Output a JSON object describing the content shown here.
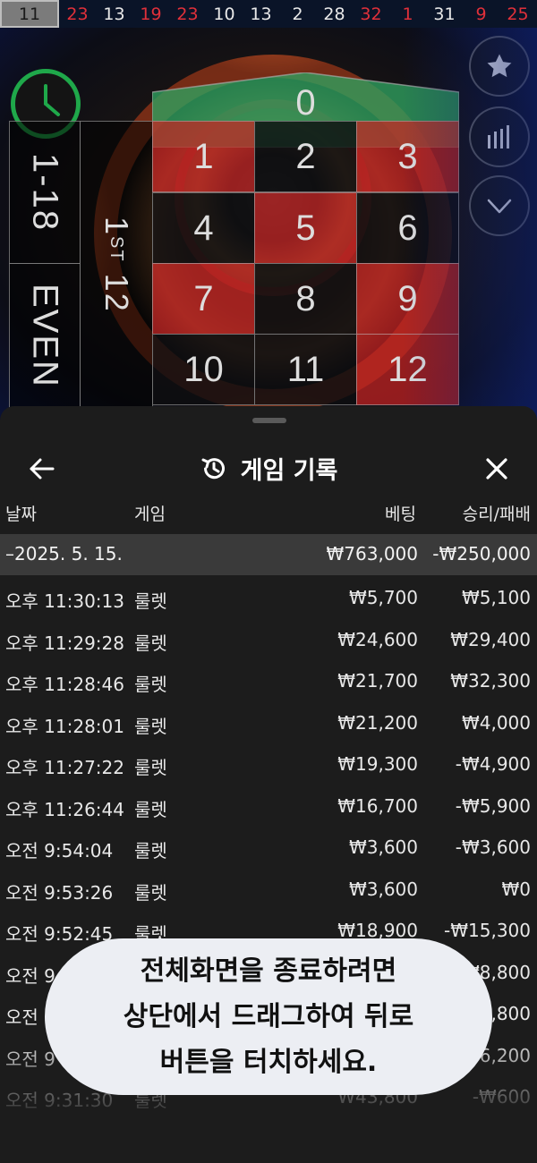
{
  "history": [
    {
      "n": "11",
      "color": "grey"
    },
    {
      "n": "23",
      "color": "red"
    },
    {
      "n": "13",
      "color": "black"
    },
    {
      "n": "19",
      "color": "red"
    },
    {
      "n": "23",
      "color": "red"
    },
    {
      "n": "10",
      "color": "black"
    },
    {
      "n": "13",
      "color": "black"
    },
    {
      "n": "2",
      "color": "black"
    },
    {
      "n": "28",
      "color": "black"
    },
    {
      "n": "32",
      "color": "red"
    },
    {
      "n": "1",
      "color": "red"
    },
    {
      "n": "31",
      "color": "black"
    },
    {
      "n": "9",
      "color": "red"
    },
    {
      "n": "25",
      "color": "red"
    }
  ],
  "table": {
    "zero": "0",
    "numbers": [
      "1",
      "2",
      "3",
      "4",
      "5",
      "6",
      "7",
      "8",
      "9",
      "10",
      "11",
      "12"
    ],
    "low": "1-18",
    "even": "EVEN",
    "dozen": "1ST 12",
    "dozen_main": "1",
    "dozen_sup": "ST",
    "dozen_num": "12"
  },
  "icons": {
    "timer": "clock-icon",
    "favorite": "star-icon",
    "stats": "bar-chart-icon",
    "collapse": "chevron-down-icon",
    "back": "arrow-left-icon",
    "history": "history-icon",
    "close": "close-icon"
  },
  "colors": {
    "red": "#c82323",
    "black": "#0e0e10",
    "zero_green": "#2fa160",
    "timer_green": "#1fa84a",
    "sheet_bg": "#1c1c1c",
    "date_row_bg": "#3a3a3a"
  },
  "sheet": {
    "title": "게임 기록",
    "columns": {
      "date": "날짜",
      "game": "게임",
      "bet": "베팅",
      "result": "승리/패배"
    },
    "date_group": {
      "label": "–2025. 5. 15.",
      "bet": "₩763,000",
      "result": "-₩250,000"
    },
    "rows": [
      {
        "time": "오후 11:30:13",
        "game": "룰렛",
        "bet": "₩5,700",
        "result": "₩5,100"
      },
      {
        "time": "오후 11:29:28",
        "game": "룰렛",
        "bet": "₩24,600",
        "result": "₩29,400"
      },
      {
        "time": "오후 11:28:46",
        "game": "룰렛",
        "bet": "₩21,700",
        "result": "₩32,300"
      },
      {
        "time": "오후 11:28:01",
        "game": "룰렛",
        "bet": "₩21,200",
        "result": "₩4,000"
      },
      {
        "time": "오후 11:27:22",
        "game": "룰렛",
        "bet": "₩19,300",
        "result": "-₩4,900"
      },
      {
        "time": "오후 11:26:44",
        "game": "룰렛",
        "bet": "₩16,700",
        "result": "-₩5,900"
      },
      {
        "time": "오전 9:54:04",
        "game": "룰렛",
        "bet": "₩3,600",
        "result": "-₩3,600"
      },
      {
        "time": "오전 9:53:26",
        "game": "룰렛",
        "bet": "₩3,600",
        "result": "₩0"
      },
      {
        "time": "오전 9:52:45",
        "game": "룰렛",
        "bet": "₩18,900",
        "result": "-₩15,300"
      },
      {
        "time": "오전 9",
        "game": "",
        "bet": "",
        "result": "₩8,800"
      },
      {
        "time": "오전",
        "game": "",
        "bet": "",
        "result": "₩,800"
      },
      {
        "time": "오전 9",
        "game": "",
        "bet": "",
        "result": "₩6,200"
      },
      {
        "time": "오전 9:31:30",
        "game": "룰렛",
        "bet": "₩43,800",
        "result": "-₩600"
      }
    ]
  },
  "toast": {
    "line1": "전체화면을 종료하려면",
    "line2": "상단에서 드래그하여 뒤로",
    "line3": "버튼을 터치하세요."
  }
}
